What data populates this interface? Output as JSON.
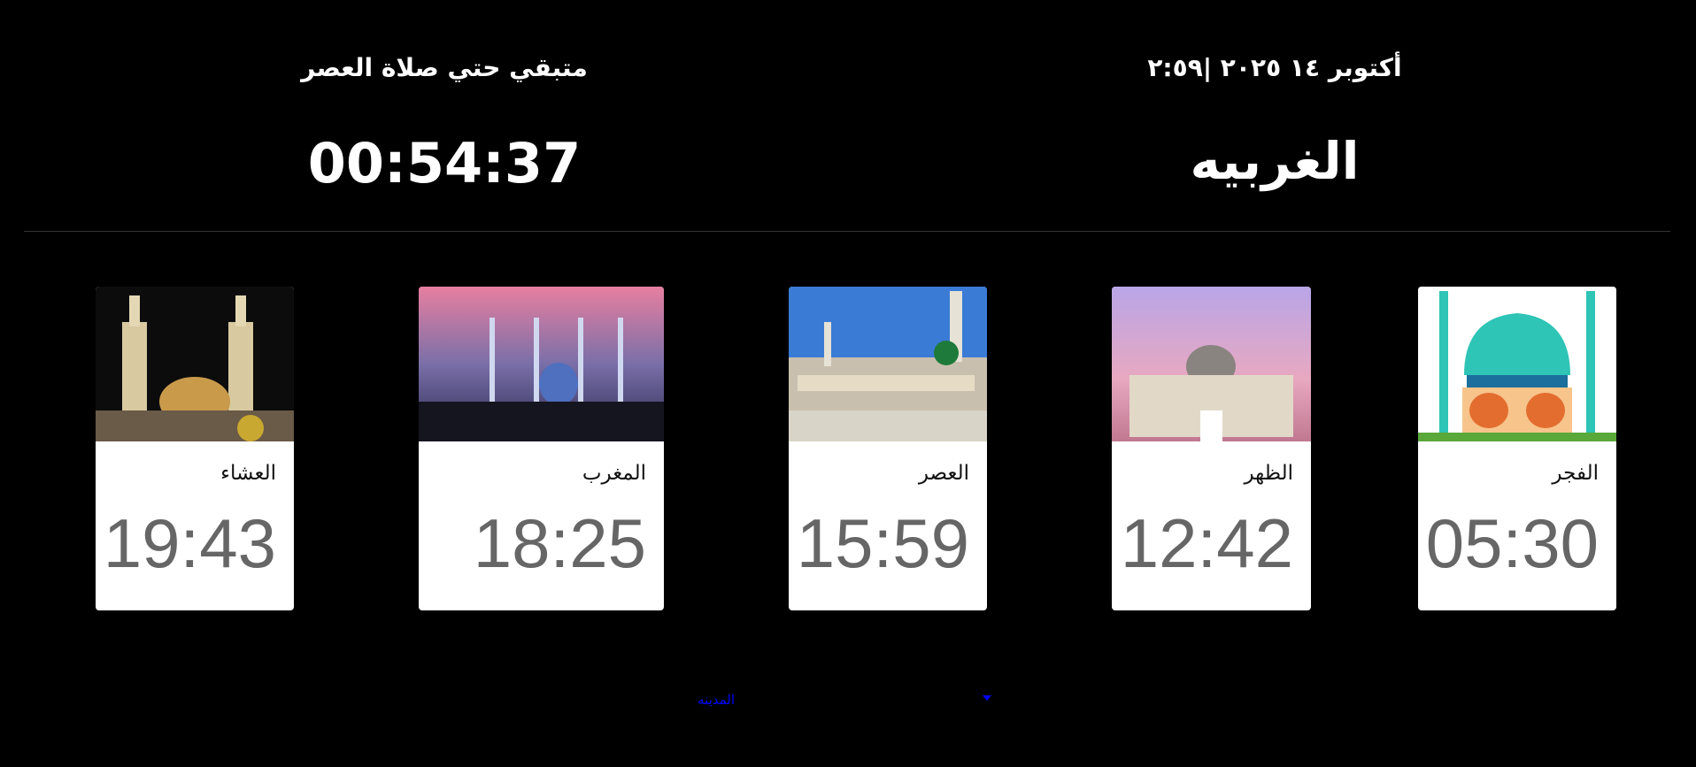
{
  "header": {
    "date_time": "أكتوبر ١٤ ٢٠٢٥ |٢:٥٩",
    "city": "الغربيه",
    "remaining_label": "متبقي حتي صلاة العصر",
    "countdown": "00:54:37"
  },
  "prayers": [
    {
      "name": "العشاء",
      "time": "19:43"
    },
    {
      "name": "المغرب",
      "time": "18:25"
    },
    {
      "name": "العصر",
      "time": "15:59"
    },
    {
      "name": "الظهر",
      "time": "12:42"
    },
    {
      "name": "الفجر",
      "time": "05:30"
    }
  ],
  "city_select": {
    "selected_label": "المدينه"
  }
}
